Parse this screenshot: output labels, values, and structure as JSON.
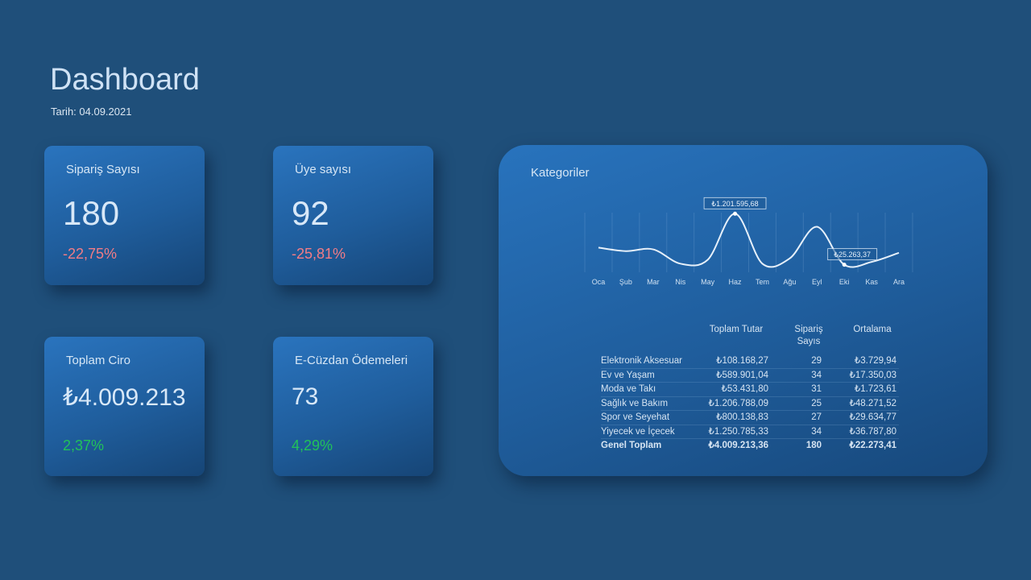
{
  "header": {
    "title": "Dashboard",
    "date": "Tarih: 04.09.2021"
  },
  "cards": [
    {
      "label": "Sipariş Sayısı",
      "value": "180",
      "change": "-22,75%",
      "trend": "negative"
    },
    {
      "label": "Üye sayısı",
      "value": "92",
      "change": "-25,81%",
      "trend": "negative"
    },
    {
      "label": "Toplam Ciro",
      "value": "₺4.009.213",
      "change": "2,37%",
      "trend": "positive"
    },
    {
      "label": "E-Cüzdan Ödemeleri",
      "value": "73",
      "change": "4,29%",
      "trend": "positive"
    }
  ],
  "panel": {
    "title": "Kategoriler"
  },
  "chart_data": {
    "type": "line",
    "title": "",
    "categories": [
      "Oca",
      "Şub",
      "Mar",
      "Nis",
      "May",
      "Haz",
      "Tem",
      "Ağu",
      "Eyl",
      "Eki",
      "Kas",
      "Ara"
    ],
    "values": [
      420000,
      340000,
      380000,
      50000,
      140000,
      1201595.68,
      50000,
      170000,
      900000,
      25263.37,
      90000,
      300000
    ],
    "annotations": [
      {
        "category": "Haz",
        "label": "₺1.201.595,68"
      },
      {
        "category": "Eki",
        "label": "₺25.263,37"
      }
    ],
    "ylim": [
      0,
      1300000
    ],
    "grid": true,
    "line_color": "#e6f0fa"
  },
  "table": {
    "columns": [
      "Toplam Tutar",
      "Sipariş Sayıs",
      "Ortalama"
    ],
    "rows": [
      {
        "name": "Elektronik Aksesuar",
        "total": "₺108.168,27",
        "count": "29",
        "avg": "₺3.729,94"
      },
      {
        "name": "Ev ve Yaşam",
        "total": "₺589.901,04",
        "count": "34",
        "avg": "₺17.350,03"
      },
      {
        "name": "Moda ve Takı",
        "total": "₺53.431,80",
        "count": "31",
        "avg": "₺1.723,61"
      },
      {
        "name": "Sağlık ve Bakım",
        "total": "₺1.206.788,09",
        "count": "25",
        "avg": "₺48.271,52"
      },
      {
        "name": "Spor ve Seyehat",
        "total": "₺800.138,83",
        "count": "27",
        "avg": "₺29.634,77"
      },
      {
        "name": "Yiyecek ve İçecek",
        "total": "₺1.250.785,33",
        "count": "34",
        "avg": "₺36.787,80"
      }
    ],
    "total_row": {
      "name": "Genel Toplam",
      "total": "₺4.009.213,36",
      "count": "180",
      "avg": "₺22.273,41"
    }
  },
  "colors": {
    "background": "#1f4f7a",
    "negative": "#f27c86",
    "positive": "#21c25a"
  }
}
